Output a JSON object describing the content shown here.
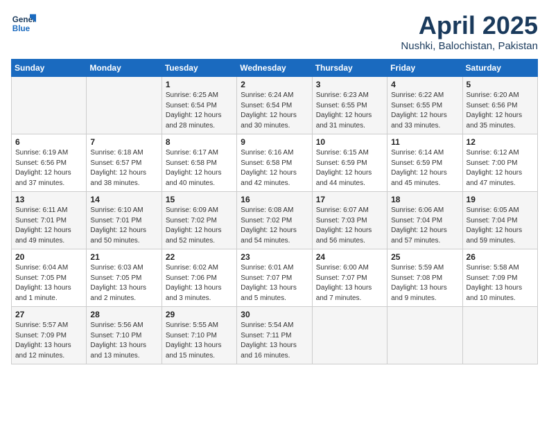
{
  "header": {
    "logo_line1": "General",
    "logo_line2": "Blue",
    "month": "April 2025",
    "location": "Nushki, Balochistan, Pakistan"
  },
  "weekdays": [
    "Sunday",
    "Monday",
    "Tuesday",
    "Wednesday",
    "Thursday",
    "Friday",
    "Saturday"
  ],
  "weeks": [
    [
      {
        "day": "",
        "info": ""
      },
      {
        "day": "",
        "info": ""
      },
      {
        "day": "1",
        "info": "Sunrise: 6:25 AM\nSunset: 6:54 PM\nDaylight: 12 hours\nand 28 minutes."
      },
      {
        "day": "2",
        "info": "Sunrise: 6:24 AM\nSunset: 6:54 PM\nDaylight: 12 hours\nand 30 minutes."
      },
      {
        "day": "3",
        "info": "Sunrise: 6:23 AM\nSunset: 6:55 PM\nDaylight: 12 hours\nand 31 minutes."
      },
      {
        "day": "4",
        "info": "Sunrise: 6:22 AM\nSunset: 6:55 PM\nDaylight: 12 hours\nand 33 minutes."
      },
      {
        "day": "5",
        "info": "Sunrise: 6:20 AM\nSunset: 6:56 PM\nDaylight: 12 hours\nand 35 minutes."
      }
    ],
    [
      {
        "day": "6",
        "info": "Sunrise: 6:19 AM\nSunset: 6:56 PM\nDaylight: 12 hours\nand 37 minutes."
      },
      {
        "day": "7",
        "info": "Sunrise: 6:18 AM\nSunset: 6:57 PM\nDaylight: 12 hours\nand 38 minutes."
      },
      {
        "day": "8",
        "info": "Sunrise: 6:17 AM\nSunset: 6:58 PM\nDaylight: 12 hours\nand 40 minutes."
      },
      {
        "day": "9",
        "info": "Sunrise: 6:16 AM\nSunset: 6:58 PM\nDaylight: 12 hours\nand 42 minutes."
      },
      {
        "day": "10",
        "info": "Sunrise: 6:15 AM\nSunset: 6:59 PM\nDaylight: 12 hours\nand 44 minutes."
      },
      {
        "day": "11",
        "info": "Sunrise: 6:14 AM\nSunset: 6:59 PM\nDaylight: 12 hours\nand 45 minutes."
      },
      {
        "day": "12",
        "info": "Sunrise: 6:12 AM\nSunset: 7:00 PM\nDaylight: 12 hours\nand 47 minutes."
      }
    ],
    [
      {
        "day": "13",
        "info": "Sunrise: 6:11 AM\nSunset: 7:01 PM\nDaylight: 12 hours\nand 49 minutes."
      },
      {
        "day": "14",
        "info": "Sunrise: 6:10 AM\nSunset: 7:01 PM\nDaylight: 12 hours\nand 50 minutes."
      },
      {
        "day": "15",
        "info": "Sunrise: 6:09 AM\nSunset: 7:02 PM\nDaylight: 12 hours\nand 52 minutes."
      },
      {
        "day": "16",
        "info": "Sunrise: 6:08 AM\nSunset: 7:02 PM\nDaylight: 12 hours\nand 54 minutes."
      },
      {
        "day": "17",
        "info": "Sunrise: 6:07 AM\nSunset: 7:03 PM\nDaylight: 12 hours\nand 56 minutes."
      },
      {
        "day": "18",
        "info": "Sunrise: 6:06 AM\nSunset: 7:04 PM\nDaylight: 12 hours\nand 57 minutes."
      },
      {
        "day": "19",
        "info": "Sunrise: 6:05 AM\nSunset: 7:04 PM\nDaylight: 12 hours\nand 59 minutes."
      }
    ],
    [
      {
        "day": "20",
        "info": "Sunrise: 6:04 AM\nSunset: 7:05 PM\nDaylight: 13 hours\nand 1 minute."
      },
      {
        "day": "21",
        "info": "Sunrise: 6:03 AM\nSunset: 7:05 PM\nDaylight: 13 hours\nand 2 minutes."
      },
      {
        "day": "22",
        "info": "Sunrise: 6:02 AM\nSunset: 7:06 PM\nDaylight: 13 hours\nand 3 minutes."
      },
      {
        "day": "23",
        "info": "Sunrise: 6:01 AM\nSunset: 7:07 PM\nDaylight: 13 hours\nand 5 minutes."
      },
      {
        "day": "24",
        "info": "Sunrise: 6:00 AM\nSunset: 7:07 PM\nDaylight: 13 hours\nand 7 minutes."
      },
      {
        "day": "25",
        "info": "Sunrise: 5:59 AM\nSunset: 7:08 PM\nDaylight: 13 hours\nand 9 minutes."
      },
      {
        "day": "26",
        "info": "Sunrise: 5:58 AM\nSunset: 7:09 PM\nDaylight: 13 hours\nand 10 minutes."
      }
    ],
    [
      {
        "day": "27",
        "info": "Sunrise: 5:57 AM\nSunset: 7:09 PM\nDaylight: 13 hours\nand 12 minutes."
      },
      {
        "day": "28",
        "info": "Sunrise: 5:56 AM\nSunset: 7:10 PM\nDaylight: 13 hours\nand 13 minutes."
      },
      {
        "day": "29",
        "info": "Sunrise: 5:55 AM\nSunset: 7:10 PM\nDaylight: 13 hours\nand 15 minutes."
      },
      {
        "day": "30",
        "info": "Sunrise: 5:54 AM\nSunset: 7:11 PM\nDaylight: 13 hours\nand 16 minutes."
      },
      {
        "day": "",
        "info": ""
      },
      {
        "day": "",
        "info": ""
      },
      {
        "day": "",
        "info": ""
      }
    ]
  ]
}
